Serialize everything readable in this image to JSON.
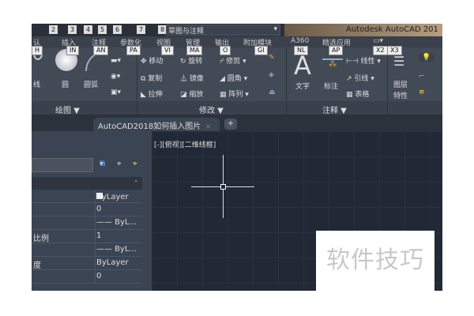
{
  "title": "Autodesk AutoCAD 201",
  "quick_access": [
    "2",
    "3",
    "4",
    "5",
    "6",
    "7",
    "8"
  ],
  "workspace": "草图与注释",
  "tabs": [
    {
      "label": "认",
      "key": "H"
    },
    {
      "label": "插入",
      "key": "IN"
    },
    {
      "label": "注释",
      "key": "AN"
    },
    {
      "label": "参数化",
      "key": "PA"
    },
    {
      "label": "视图",
      "key": "VI"
    },
    {
      "label": "管理",
      "key": "MA"
    },
    {
      "label": "输出",
      "key": "O"
    },
    {
      "label": "附加模块",
      "key": "GI"
    },
    {
      "label": "A360",
      "key": "NL"
    },
    {
      "label": "精选应用",
      "key": "AP"
    }
  ],
  "extra_keys": [
    "X2",
    "X3"
  ],
  "draw": {
    "polyline": "线",
    "circle": "圆",
    "arc": "圆弧",
    "label": "绘图 ▼"
  },
  "modify": {
    "move": "移动",
    "rotate": "旋转",
    "trim": "修剪",
    "copy": "复制",
    "mirror": "镜像",
    "fillet": "圆角",
    "stretch": "拉伸",
    "scale": "缩放",
    "array": "阵列",
    "label": "修改 ▼"
  },
  "annotation": {
    "text": "文字",
    "dimension": "标注",
    "linear": "线性",
    "leader": "引线",
    "table": "表格",
    "label": "注释 ▼"
  },
  "layers": {
    "properties": "图层\n特性",
    "l1": "图层",
    "l2": "特性"
  },
  "document_tab": "AutoCAD2018如何插入图片",
  "viewport_label": "[-][俯视][二维线框]",
  "properties": {
    "collapse": "-",
    "rows": [
      {
        "label": "",
        "value": "ByLayer"
      },
      {
        "label": "",
        "value": "0"
      },
      {
        "label": "",
        "value": "—— ByL..."
      },
      {
        "label": "比例",
        "value": "1"
      },
      {
        "label": "",
        "value": "—— ByL..."
      },
      {
        "label": "度",
        "value": "ByLayer"
      },
      {
        "label": "",
        "value": "0"
      }
    ]
  },
  "watermark": "软件技巧"
}
